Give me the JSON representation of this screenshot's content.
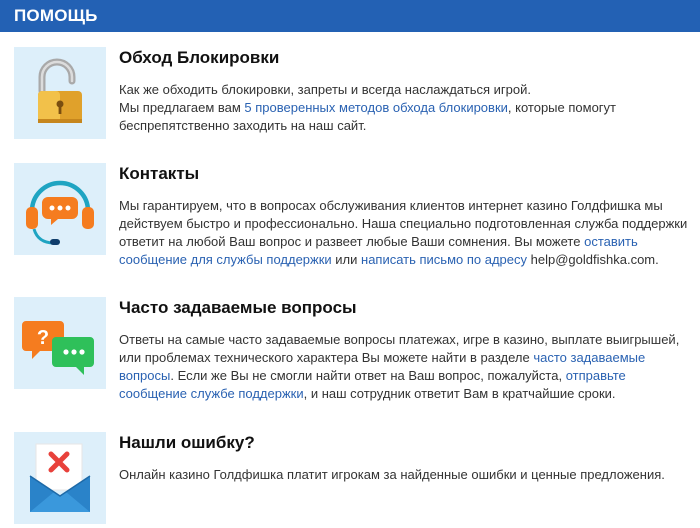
{
  "header": {
    "title": "ПОМОЩЬ"
  },
  "sections": [
    {
      "title": "Обход Блокировки",
      "lines": [
        {
          "text": "Как же обходить блокировки, запреты и всегда наслаждаться игрой."
        },
        {
          "pre": "Мы предлагаем вам ",
          "link": "5 проверенных методов обхода блокировки",
          "post": ", которые помогут"
        },
        {
          "text": "беспрепятственно заходить на наш сайт."
        }
      ]
    },
    {
      "title": "Контакты",
      "p1": "Мы гарантируем, что в вопросах обслуживания клиентов интернет казино Голдфишка мы действуем быстро и профессионально. Наша специально подготовленная служба поддержки ответит на любой Ваш вопрос и развеет любые Ваши сомнения. Вы можете ",
      "link1": "оставить сообщение для службы поддержки",
      "mid": " или ",
      "link2": "написать письмо по адресу",
      "email": " help@goldfishka.com",
      "end": "."
    },
    {
      "title": "Часто задаваемые вопросы",
      "p1": "Ответы на самые часто задаваемые вопросы платежах, игре в казино, выплате выигрышей, или проблемах технического характера Вы можете найти в разделе ",
      "link1": "часто задаваемые вопросы",
      "mid": ". Если же Вы не смогли найти ответ на Ваш вопрос, пожалуйста, ",
      "link2": "отправьте сообщение службе поддержки",
      "end": ", и наш сотрудник ответит Вам в кратчайшие сроки."
    },
    {
      "title": "Нашли ошибку?",
      "text": "Онлайн казино Голдфишка платит игрокам за найденные ошибки и ценные предложения."
    }
  ],
  "colors": {
    "header": "#2361b4",
    "icon_bg": "#ddeffa",
    "link": "#2a62b2"
  },
  "icons": [
    "padlock-icon",
    "headset-icon",
    "chat-bubbles-icon",
    "envelope-error-icon"
  ]
}
